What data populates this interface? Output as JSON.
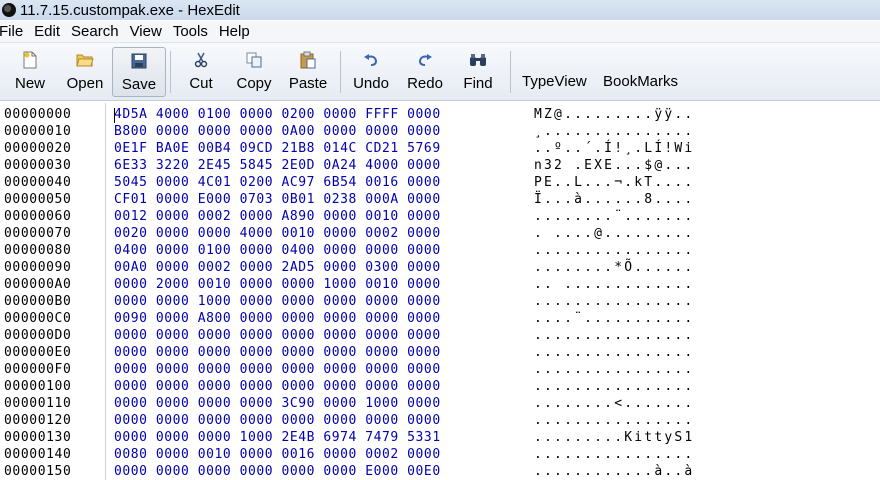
{
  "window": {
    "title": "11.7.15.custompak.exe - HexEdit"
  },
  "menu": [
    "File",
    "Edit",
    "Search",
    "View",
    "Tools",
    "Help"
  ],
  "toolbar": {
    "new": "New",
    "open": "Open",
    "save": "Save",
    "cut": "Cut",
    "copy": "Copy",
    "paste": "Paste",
    "undo": "Undo",
    "redo": "Redo",
    "find": "Find",
    "typeview": "TypeView",
    "bookmarks": "BookMarks"
  },
  "rows": [
    {
      "addr": "00000000",
      "hex": "4D5A 4000 0100 0000 0200 0000 FFFF 0000",
      "ascii": "MZ@.........ÿÿ.."
    },
    {
      "addr": "00000010",
      "hex": "B800 0000 0000 0000 0A00 0000 0000 0000",
      "ascii": "¸..............."
    },
    {
      "addr": "00000020",
      "hex": "0E1F BA0E 00B4 09CD 21B8 014C CD21 5769",
      "ascii": "..º..´.Í!¸.LÍ!Wi"
    },
    {
      "addr": "00000030",
      "hex": "6E33 3220 2E45 5845 2E0D 0A24 4000 0000",
      "ascii": "n32 .EXE...$@..."
    },
    {
      "addr": "00000040",
      "hex": "5045 0000 4C01 0200 AC97 6B54 0016 0000",
      "ascii": "PE..L...¬.kT...."
    },
    {
      "addr": "00000050",
      "hex": "CF01 0000 E000 0703 0B01 0238 000A 0000",
      "ascii": "Ï...à......8...."
    },
    {
      "addr": "00000060",
      "hex": "0012 0000 0002 0000 A890 0000 0010 0000",
      "ascii": "........¨......."
    },
    {
      "addr": "00000070",
      "hex": "0020 0000 0000 4000 0010 0000 0002 0000",
      "ascii": ". ....@........."
    },
    {
      "addr": "00000080",
      "hex": "0400 0000 0100 0000 0400 0000 0000 0000",
      "ascii": "................"
    },
    {
      "addr": "00000090",
      "hex": "00A0 0000 0002 0000 2AD5 0000 0300 0000",
      "ascii": "........*Õ......"
    },
    {
      "addr": "000000A0",
      "hex": "0000 2000 0010 0000 0000 1000 0010 0000",
      "ascii": ".. ............."
    },
    {
      "addr": "000000B0",
      "hex": "0000 0000 1000 0000 0000 0000 0000 0000",
      "ascii": "................"
    },
    {
      "addr": "000000C0",
      "hex": "0090 0000 A800 0000 0000 0000 0000 0000",
      "ascii": "....¨..........."
    },
    {
      "addr": "000000D0",
      "hex": "0000 0000 0000 0000 0000 0000 0000 0000",
      "ascii": "................"
    },
    {
      "addr": "000000E0",
      "hex": "0000 0000 0000 0000 0000 0000 0000 0000",
      "ascii": "................"
    },
    {
      "addr": "000000F0",
      "hex": "0000 0000 0000 0000 0000 0000 0000 0000",
      "ascii": "................"
    },
    {
      "addr": "00000100",
      "hex": "0000 0000 0000 0000 0000 0000 0000 0000",
      "ascii": "................"
    },
    {
      "addr": "00000110",
      "hex": "0000 0000 0000 0000 3C90 0000 1000 0000",
      "ascii": "........<......."
    },
    {
      "addr": "00000120",
      "hex": "0000 0000 0000 0000 0000 0000 0000 0000",
      "ascii": "................"
    },
    {
      "addr": "00000130",
      "hex": "0000 0000 0000 1000 2E4B 6974 7479 5331",
      "ascii": ".........KittyS1"
    },
    {
      "addr": "00000140",
      "hex": "0080 0000 0010 0000 0016 0000 0002 0000",
      "ascii": "................"
    },
    {
      "addr": "00000150",
      "hex": "0000 0000 0000 0000 0000 0000 E000 00E0",
      "ascii": "............à..à"
    }
  ]
}
